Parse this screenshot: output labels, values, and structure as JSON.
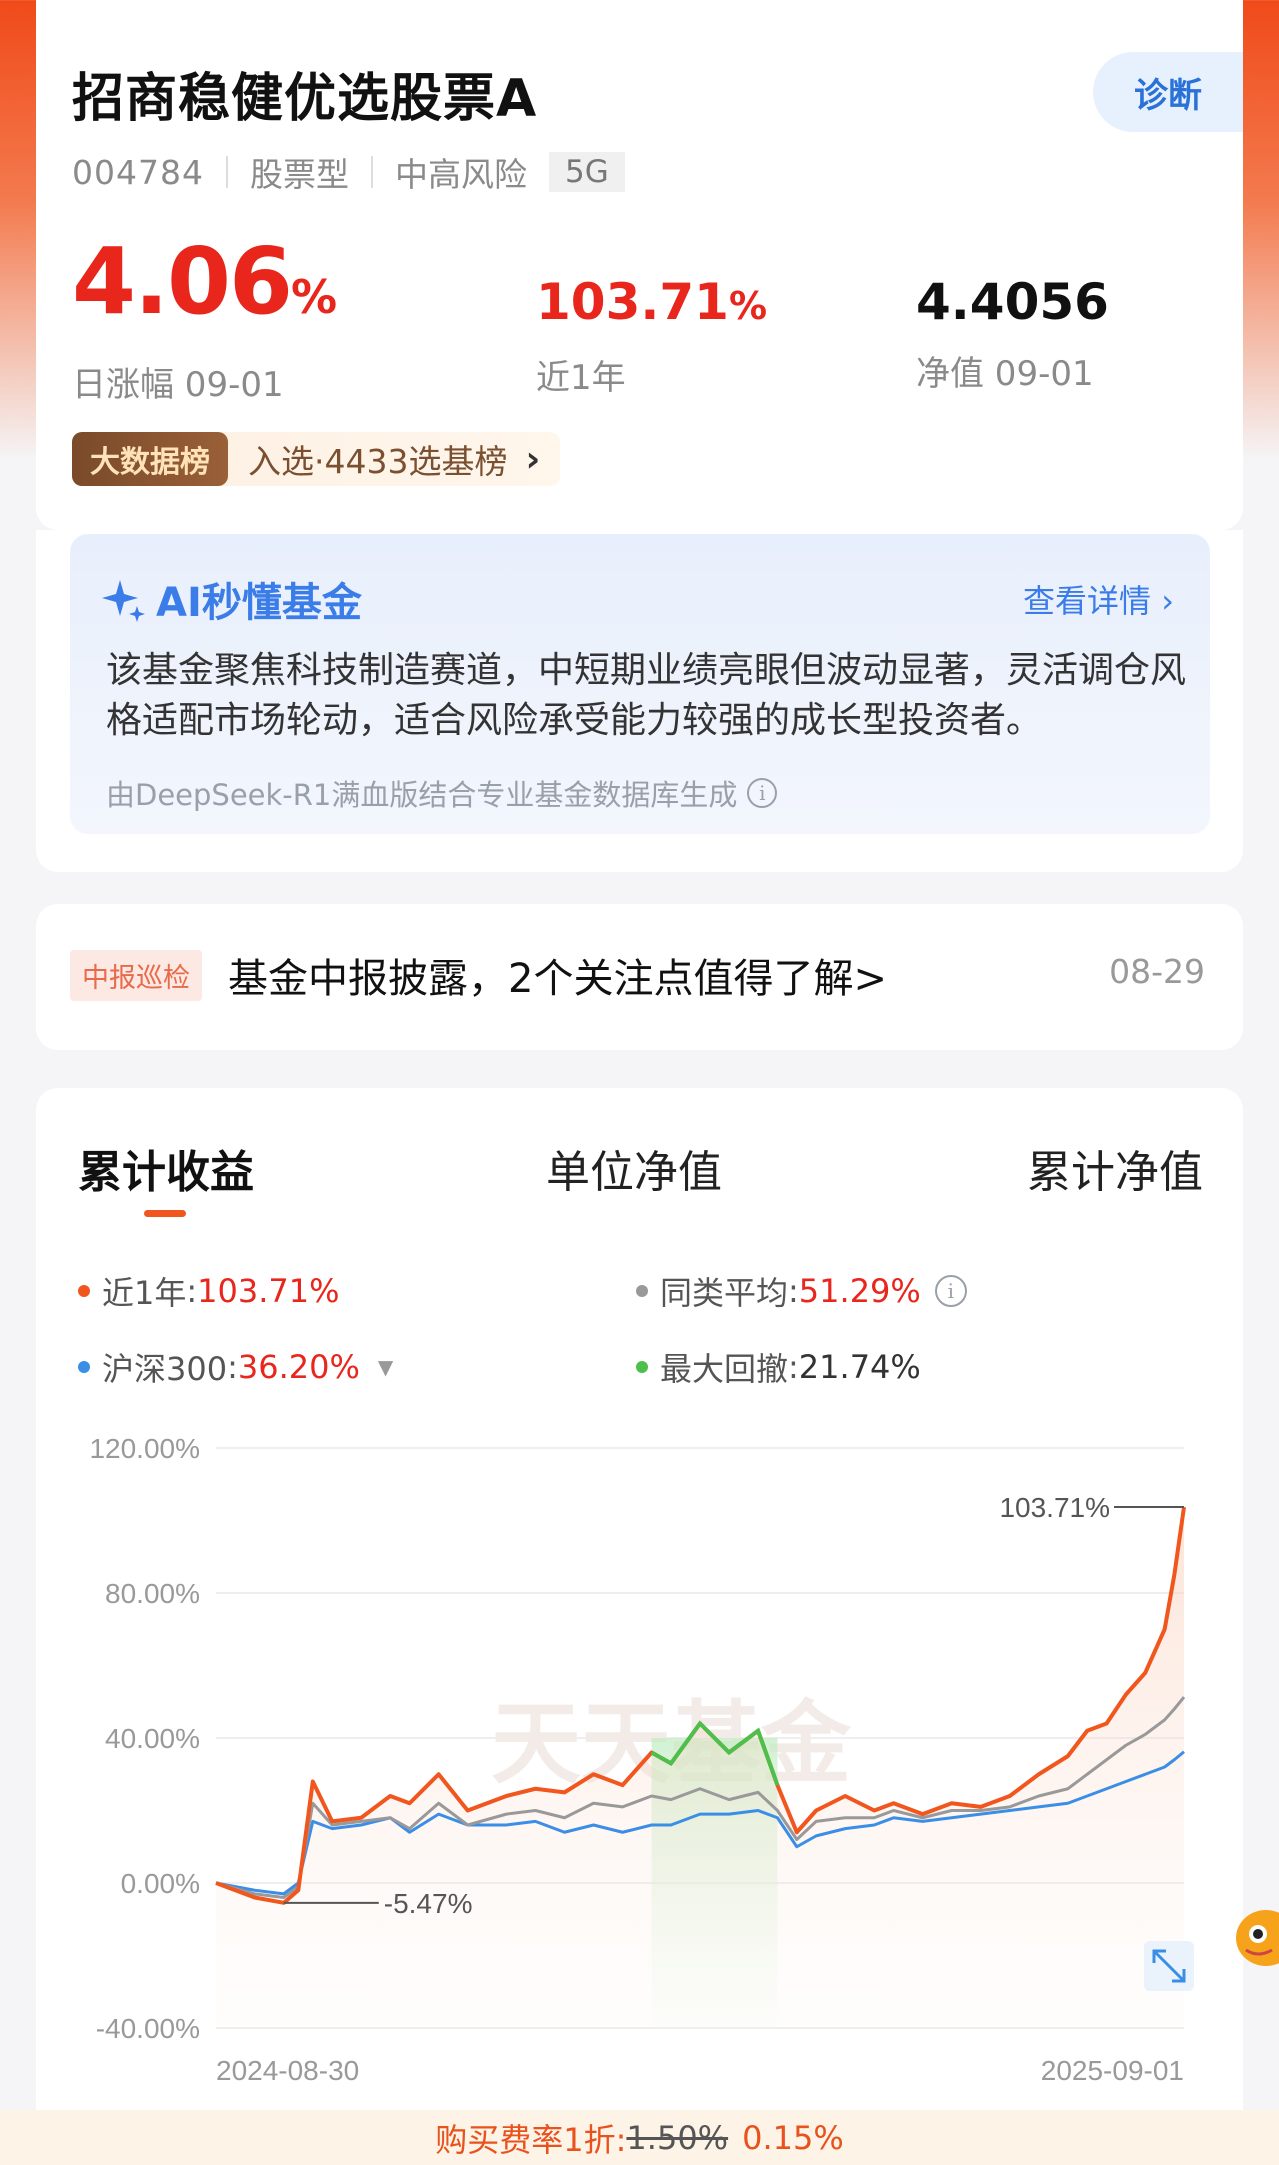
{
  "fund": {
    "name": "招商稳健优选股票A",
    "code": "004784",
    "type": "股票型",
    "risk": "中高风险",
    "tag": "5G",
    "diagnose_label": "诊断"
  },
  "stats": {
    "day_change_value": "4.06",
    "day_change_unit": "%",
    "day_change_label": "日涨幅 09-01",
    "year_return_value": "103.71",
    "year_return_unit": "%",
    "year_return_label": "近1年",
    "nav_value": "4.4056",
    "nav_label": "净值 09-01"
  },
  "bigdata": {
    "badge": "大数据榜",
    "text": "入选·4433选基榜",
    "chevron": "›"
  },
  "ai": {
    "title": "AI秒懂基金",
    "link": "查看详情 ›",
    "summary": "该基金聚焦科技制造赛道，中短期业绩亮眼但波动显著，灵活调仓风格适配市场轮动，适合风险承受能力较强的成长型投资者。",
    "footnote": "由DeepSeek-R1满血版结合专业基金数据库生成",
    "info_icon": "i"
  },
  "report": {
    "tag": "中报巡检",
    "text": "基金中报披露，2个关注点值得了解>",
    "date": "08-29"
  },
  "chart_tabs": [
    "累计收益",
    "单位净值",
    "累计净值"
  ],
  "legend": [
    {
      "name": "近1年",
      "value": "103.71%",
      "color": "#f0561d"
    },
    {
      "name": "同类平均",
      "value": "51.29%",
      "color": "#999999"
    },
    {
      "name": "沪深300",
      "value": "36.20%",
      "color": "#3a8ee6"
    },
    {
      "name": "最大回撤",
      "value": "21.74%",
      "color": "#4cbf4c"
    }
  ],
  "legend_caret": "▼",
  "legend_info": "i",
  "watermark": "天天基金",
  "fee": {
    "label": "购买费率1折:",
    "original": "1.50%",
    "discounted": "0.15%"
  },
  "chart_data": {
    "type": "line",
    "ylim": [
      -40,
      120
    ],
    "yticks": [
      "120.00%",
      "80.00%",
      "40.00%",
      "0.00%",
      "-40.00%"
    ],
    "ytick_values": [
      120,
      80,
      40,
      0,
      -40
    ],
    "xticks": [
      "2024-08-30",
      "2025-09-01"
    ],
    "annotations": {
      "max": "103.71%",
      "min": "-5.47%"
    },
    "x": [
      0,
      0.04,
      0.07,
      0.085,
      0.1,
      0.12,
      0.15,
      0.18,
      0.2,
      0.23,
      0.26,
      0.3,
      0.33,
      0.36,
      0.39,
      0.42,
      0.45,
      0.47,
      0.5,
      0.53,
      0.56,
      0.58,
      0.6,
      0.62,
      0.65,
      0.68,
      0.7,
      0.73,
      0.76,
      0.79,
      0.82,
      0.85,
      0.88,
      0.9,
      0.92,
      0.94,
      0.96,
      0.98,
      0.99,
      1.0
    ],
    "series": [
      {
        "name": "近1年",
        "color": "#f0561d",
        "values": [
          0,
          -4,
          -5.47,
          -2,
          28,
          17,
          18,
          24,
          22,
          30,
          20,
          24,
          26,
          25,
          30,
          27,
          36,
          33,
          44,
          36,
          42,
          27,
          14,
          20,
          24,
          20,
          22,
          19,
          22,
          21,
          24,
          30,
          35,
          42,
          44,
          52,
          58,
          70,
          85,
          103.71
        ]
      },
      {
        "name": "同类平均",
        "color": "#999999",
        "values": [
          0,
          -3,
          -4,
          -1,
          22,
          16,
          17,
          18,
          15,
          22,
          16,
          19,
          20,
          18,
          22,
          21,
          24,
          23,
          26,
          23,
          25,
          20,
          12,
          17,
          18,
          18,
          20,
          18,
          20,
          20,
          21,
          24,
          26,
          30,
          34,
          38,
          41,
          45,
          48,
          51.29
        ]
      },
      {
        "name": "沪深300",
        "color": "#3a8ee6",
        "values": [
          0,
          -2,
          -3,
          0,
          17,
          15,
          16,
          18,
          14,
          19,
          16,
          16,
          17,
          14,
          16,
          14,
          16,
          16,
          19,
          19,
          20,
          18,
          10,
          13,
          15,
          16,
          18,
          17,
          18,
          19,
          20,
          21,
          22,
          24,
          26,
          28,
          30,
          32,
          34,
          36.2
        ]
      }
    ],
    "drawdown": {
      "name": "最大回撤",
      "start_x": 0.45,
      "end_x": 0.58,
      "color": "#4cbf4c"
    }
  }
}
